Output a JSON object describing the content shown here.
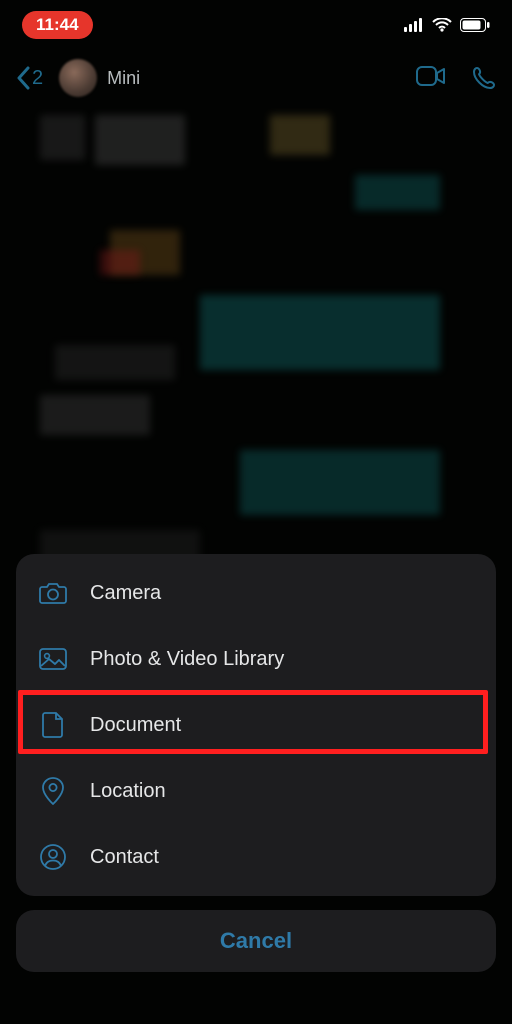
{
  "status": {
    "time": "11:44"
  },
  "header": {
    "back_count": "2",
    "contact_name": "Mini"
  },
  "sheet": {
    "items": [
      {
        "label": "Camera",
        "icon": "camera-icon"
      },
      {
        "label": "Photo & Video Library",
        "icon": "photo-icon"
      },
      {
        "label": "Document",
        "icon": "document-icon"
      },
      {
        "label": "Location",
        "icon": "location-icon"
      },
      {
        "label": "Contact",
        "icon": "contact-icon"
      }
    ],
    "highlight_index": 2,
    "cancel_label": "Cancel"
  },
  "colors": {
    "accent": "#2f7aa8",
    "highlight": "#ff1f1f",
    "recording": "#e6352b"
  }
}
